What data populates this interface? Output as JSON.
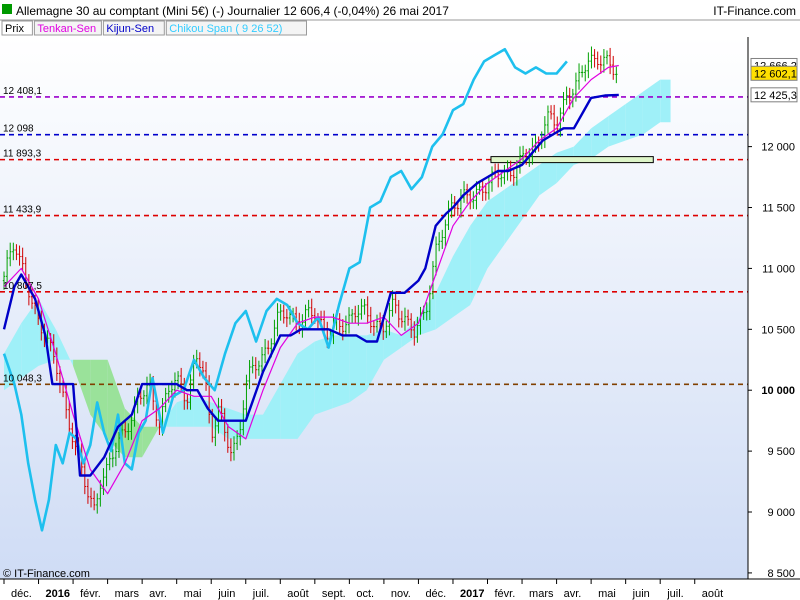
{
  "header": {
    "title": "Allemagne 30 au comptant (Mini 5€) (-)   Journalier   12 606,4 (-0,04%)   26 mai 2017",
    "brand": "IT-Finance.com",
    "copyright": "© IT-Finance.com"
  },
  "legend": [
    {
      "label": "Prix",
      "color": "#000000"
    },
    {
      "label": "Tenkan-Sen",
      "color": "#e100e1"
    },
    {
      "label": "Kijun-Sen",
      "color": "#0000c8"
    },
    {
      "label": "Chikou Span ( 9 26 52)",
      "color": "#33ccff"
    }
  ],
  "colors": {
    "background_top": "#ffffff",
    "background_bottom": "#cfdcf5",
    "tenkan": "#e100e1",
    "kijun": "#0000c8",
    "chikou": "#1ec0ee",
    "kumo_bull": "#9ff0f8",
    "kumo_bear": "#9ae29a",
    "candle_up": "#00a000",
    "candle_down": "#d00000"
  },
  "chart_data": {
    "type": "line",
    "title": "Allemagne 30 au comptant (Mini 5€) (-)   Journalier   12 606,4 (-0,04%)   26 mai 2017",
    "ylim": [
      8450,
      12900
    ],
    "grid": false,
    "y_ticks": [
      "8 500",
      "9 000",
      "9 500",
      "10 000",
      "10 500",
      "11 000",
      "11 500",
      "12 000"
    ],
    "y_tick_values": [
      8500,
      9000,
      9500,
      10000,
      10500,
      11000,
      11500,
      12000
    ],
    "x_ticks": [
      "déc.",
      "2016",
      "févr.",
      "mars",
      "avr.",
      "mai",
      "juin",
      "juil.",
      "août",
      "sept.",
      "oct.",
      "nov.",
      "déc.",
      "2017",
      "févr.",
      "mars",
      "avr.",
      "mai",
      "juin",
      "juil.",
      "août"
    ],
    "x_tick_months": [
      0,
      1,
      2,
      3,
      4,
      5,
      6,
      7,
      8,
      9,
      10,
      11,
      12,
      13,
      14,
      15,
      16,
      17,
      18,
      19,
      20
    ],
    "x_tick_bold": [
      false,
      true,
      false,
      false,
      false,
      false,
      false,
      false,
      false,
      false,
      false,
      false,
      false,
      true,
      false,
      false,
      false,
      false,
      false,
      false,
      false
    ],
    "levels": [
      {
        "value": 12408.1,
        "label": "12 408,1",
        "color": "#9900cc"
      },
      {
        "value": 12098,
        "label": "12 098",
        "color": "#0000cc"
      },
      {
        "value": 11893.3,
        "label": "11 893,3",
        "color": "#dd0000"
      },
      {
        "value": 11433.9,
        "label": "11 433,9",
        "color": "#dd0000"
      },
      {
        "value": 10807.5,
        "label": "10 807,5",
        "color": "#dd0000"
      },
      {
        "value": 10048.3,
        "label": "10 048,3",
        "color": "#804000"
      }
    ],
    "price_tags": [
      {
        "value": 12666.2,
        "label": "12 666,2",
        "bg": "#ffffff",
        "fg": "#e100e1"
      },
      {
        "value": 12602.1,
        "label": "12 602,1",
        "bg": "#ffe000",
        "fg": "#000000"
      },
      {
        "value": 12425.3,
        "label": "12 425,3",
        "bg": "#ffffff",
        "fg": "#0000cc"
      }
    ],
    "last_price": 12602.1,
    "x_range_months": [
      0,
      20.5
    ],
    "close_series": {
      "name": "Prix",
      "x": [
        0,
        0.3,
        0.5,
        0.8,
        1.0,
        1.2,
        1.5,
        1.8,
        2.0,
        2.2,
        2.4,
        2.6,
        2.8,
        3.0,
        3.3,
        3.6,
        3.9,
        4.2,
        4.5,
        4.8,
        5.0,
        5.3,
        5.6,
        5.8,
        6.0,
        6.2,
        6.4,
        6.6,
        6.8,
        7.0,
        7.3,
        7.6,
        7.9,
        8.2,
        8.6,
        9.0,
        9.4,
        9.8,
        10.2,
        10.6,
        11.0,
        11.3,
        11.6,
        11.9,
        12.2,
        12.5,
        12.8,
        13.0,
        13.3,
        13.6,
        13.9,
        14.2,
        14.5,
        14.8,
        15.1,
        15.4,
        15.7,
        16.0,
        16.3,
        16.6,
        16.9,
        17.2,
        17.5,
        17.8
      ],
      "values": [
        10900,
        11250,
        11050,
        10700,
        10550,
        10500,
        10200,
        9800,
        9650,
        9400,
        9150,
        9000,
        9300,
        9350,
        9550,
        9750,
        9900,
        10050,
        9750,
        10000,
        10100,
        9950,
        10250,
        10150,
        9650,
        9850,
        9600,
        9500,
        9650,
        10050,
        10200,
        10350,
        10550,
        10650,
        10550,
        10650,
        10450,
        10550,
        10650,
        10600,
        10500,
        10700,
        10600,
        10450,
        10650,
        11150,
        11350,
        11550,
        11600,
        11550,
        11700,
        11750,
        11750,
        11850,
        11900,
        12000,
        12250,
        12150,
        12450,
        12500,
        12700,
        12750,
        12650,
        12600
      ]
    },
    "series": [
      {
        "name": "Tenkan-Sen",
        "x": [
          0,
          0.5,
          1.0,
          1.5,
          2.0,
          2.5,
          3.0,
          3.5,
          4.0,
          4.5,
          5.0,
          5.5,
          6.0,
          6.5,
          7.0,
          7.5,
          8.0,
          8.5,
          9.0,
          9.5,
          10.0,
          10.5,
          11.0,
          11.5,
          12.0,
          12.5,
          13.0,
          13.5,
          14.0,
          14.5,
          15.0,
          15.5,
          16.0,
          16.5,
          17.0,
          17.5,
          17.8
        ],
        "values": [
          10850,
          11000,
          10750,
          10300,
          9800,
          9350,
          9150,
          9400,
          9750,
          9850,
          10000,
          9950,
          9950,
          9700,
          9600,
          10000,
          10350,
          10550,
          10600,
          10600,
          10550,
          10550,
          10600,
          10450,
          10550,
          10950,
          11350,
          11550,
          11700,
          11800,
          11900,
          12050,
          12150,
          12400,
          12550,
          12650,
          12666
        ]
      },
      {
        "name": "Kijun-Sen",
        "x": [
          0,
          0.3,
          0.5,
          0.9,
          1.2,
          1.4,
          2.0,
          2.2,
          2.5,
          2.9,
          3.3,
          3.7,
          4.0,
          4.3,
          4.7,
          5.0,
          5.3,
          5.6,
          5.9,
          6.2,
          6.6,
          7.0,
          7.5,
          8.0,
          8.3,
          8.6,
          9.0,
          9.4,
          9.8,
          10.2,
          10.5,
          10.8,
          11.2,
          11.6,
          12.0,
          12.2,
          12.5,
          12.8,
          13.0,
          13.3,
          13.7,
          14.0,
          14.3,
          14.6,
          15.0,
          15.3,
          15.6,
          15.9,
          16.2,
          16.5,
          16.8,
          17.0,
          17.4,
          17.8
        ],
        "values": [
          10500,
          10850,
          10950,
          10750,
          10450,
          10050,
          10050,
          9300,
          9300,
          9450,
          9700,
          9800,
          10050,
          10050,
          10050,
          10050,
          10000,
          10000,
          9850,
          9750,
          9750,
          9750,
          10150,
          10450,
          10450,
          10500,
          10500,
          10500,
          10450,
          10450,
          10400,
          10400,
          10800,
          10800,
          10900,
          11000,
          11350,
          11450,
          11500,
          11600,
          11700,
          11750,
          11800,
          11800,
          11850,
          11950,
          12050,
          12100,
          12150,
          12150,
          12300,
          12400,
          12420,
          12425
        ]
      },
      {
        "name": "Chikou Span ( 9 26 52)",
        "x": [
          0,
          0.3,
          0.5,
          0.7,
          0.9,
          1.1,
          1.3,
          1.5,
          1.7,
          1.9,
          2.1,
          2.3,
          2.5,
          2.7,
          2.9,
          3.1,
          3.3,
          3.5,
          3.7,
          3.9,
          4.1,
          4.3,
          4.6,
          4.9,
          5.2,
          5.5,
          5.8,
          6.1,
          6.4,
          6.7,
          7.0,
          7.3,
          7.6,
          7.9,
          8.2,
          8.5,
          8.8,
          9.1,
          9.4,
          9.7,
          10.0,
          10.3,
          10.6,
          10.9,
          11.2,
          11.5,
          11.8,
          12.1,
          12.4,
          12.7,
          13.0,
          13.3,
          13.6,
          13.9,
          14.2,
          14.5,
          14.8,
          15.1,
          15.4,
          15.7,
          16.0,
          16.3
        ],
        "values": [
          10300,
          10050,
          9800,
          9400,
          9100,
          8850,
          9100,
          9550,
          9400,
          9650,
          9600,
          9400,
          9550,
          9900,
          9650,
          9500,
          9800,
          9400,
          9350,
          9650,
          9750,
          10100,
          9650,
          9950,
          10000,
          10250,
          10100,
          10000,
          10300,
          10550,
          10650,
          10400,
          10650,
          10750,
          10700,
          10550,
          10500,
          10600,
          10350,
          10700,
          11000,
          11050,
          11500,
          11550,
          11750,
          11800,
          11650,
          11750,
          12000,
          12100,
          12300,
          12350,
          12550,
          12700,
          12750,
          12800,
          12650,
          12600,
          12650,
          12600,
          12600,
          12700
        ]
      }
    ],
    "kumo": {
      "x": [
        0,
        0.5,
        1.0,
        1.5,
        2.0,
        2.5,
        3.0,
        3.5,
        4.0,
        4.5,
        5.0,
        5.5,
        6.0,
        6.5,
        7.0,
        7.5,
        8.0,
        8.5,
        9.0,
        9.5,
        10.0,
        10.5,
        11.0,
        11.5,
        12.0,
        12.5,
        13.0,
        13.5,
        14.0,
        14.5,
        15.0,
        15.5,
        16.0,
        16.5,
        17.0,
        17.5,
        18.0,
        18.5,
        19.0,
        19.3
      ],
      "span_a": [
        10300,
        10550,
        10750,
        10500,
        10200,
        9800,
        9600,
        9450,
        9450,
        9700,
        9900,
        9950,
        9900,
        9850,
        9800,
        9800,
        10050,
        10300,
        10400,
        10450,
        10450,
        10450,
        10500,
        10450,
        10600,
        10800,
        11100,
        11350,
        11550,
        11650,
        11750,
        11850,
        11950,
        12000,
        12150,
        12250,
        12350,
        12450,
        12550,
        12550
      ],
      "span_b": [
        10000,
        10100,
        10200,
        10250,
        10250,
        10250,
        10250,
        9850,
        9700,
        9700,
        9700,
        9700,
        9700,
        9600,
        9600,
        9600,
        9600,
        9600,
        9800,
        9850,
        9900,
        10000,
        10250,
        10350,
        10450,
        10500,
        10600,
        10700,
        11000,
        11200,
        11400,
        11600,
        11700,
        11850,
        11900,
        12000,
        12050,
        12100,
        12200,
        12200
      ]
    }
  }
}
